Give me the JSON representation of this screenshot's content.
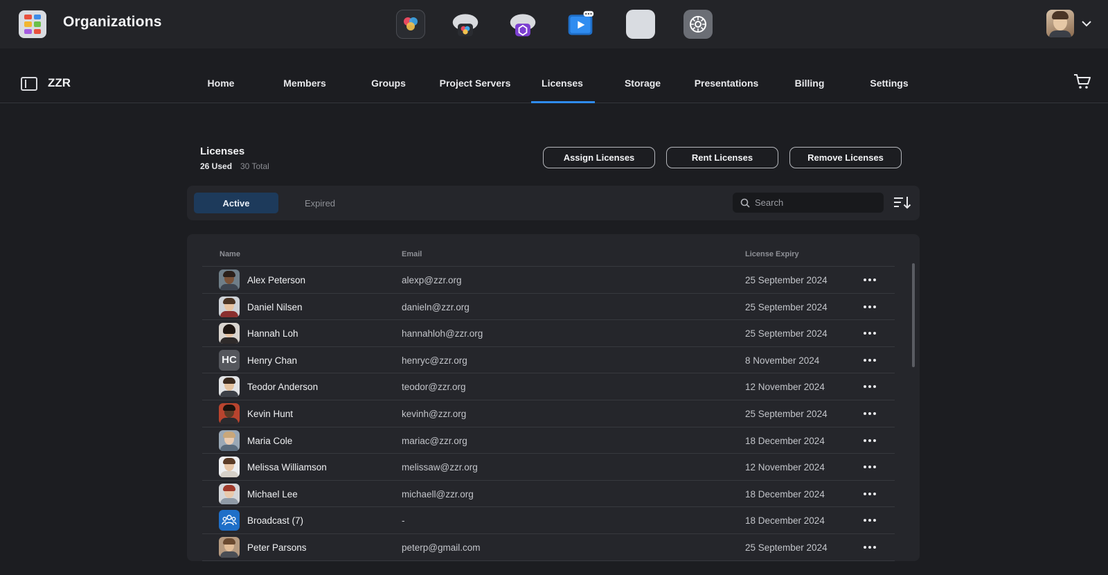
{
  "app": {
    "title": "Organizations"
  },
  "dock_apps": [
    {
      "icon": "davinci-resolve-icon"
    },
    {
      "icon": "cloud-resolve-icon"
    },
    {
      "icon": "cloud-database-icon"
    },
    {
      "icon": "presentation-player-icon"
    },
    {
      "icon": "organizations-icon"
    },
    {
      "icon": "system-preferences-icon"
    }
  ],
  "nav": {
    "org_name": "ZZR",
    "items": [
      {
        "label": "Home"
      },
      {
        "label": "Members"
      },
      {
        "label": "Groups"
      },
      {
        "label": "Project Servers"
      },
      {
        "label": "Licenses"
      },
      {
        "label": "Storage"
      },
      {
        "label": "Presentations"
      },
      {
        "label": "Billing"
      },
      {
        "label": "Settings"
      }
    ],
    "active": "Licenses"
  },
  "licenses": {
    "title": "Licenses",
    "used": "26 Used",
    "total": "30 Total",
    "buttons": {
      "assign": "Assign Licenses",
      "rent": "Rent Licenses",
      "remove": "Remove Licenses"
    },
    "tabs": {
      "active": "Active",
      "expired": "Expired"
    },
    "search": {
      "placeholder": "Search",
      "value": ""
    },
    "columns": {
      "name": "Name",
      "email": "Email",
      "expiry": "License Expiry"
    },
    "rows": [
      {
        "name": "Alex Peterson",
        "email": "alexp@zzr.org",
        "expiry": "25 September 2024"
      },
      {
        "name": "Daniel Nilsen",
        "email": "danieln@zzr.org",
        "expiry": "25 September 2024"
      },
      {
        "name": "Hannah Loh",
        "email": "hannahloh@zzr.org",
        "expiry": "25 September 2024"
      },
      {
        "name": "Henry Chan",
        "email": "henryc@zzr.org",
        "expiry": "8 November 2024",
        "initials": "HC"
      },
      {
        "name": "Teodor Anderson",
        "email": "teodor@zzr.org",
        "expiry": "12 November 2024"
      },
      {
        "name": "Kevin Hunt",
        "email": "kevinh@zzr.org",
        "expiry": "25 September 2024"
      },
      {
        "name": "Maria Cole",
        "email": "mariac@zzr.org",
        "expiry": "18 December 2024"
      },
      {
        "name": "Melissa Williamson",
        "email": "melissaw@zzr.org",
        "expiry": "12 November 2024"
      },
      {
        "name": "Michael Lee",
        "email": "michaell@zzr.org",
        "expiry": "18 December 2024"
      },
      {
        "name": "Broadcast (7)",
        "email": "-",
        "expiry": "18 December 2024"
      },
      {
        "name": "Peter Parsons",
        "email": "peterp@gmail.com",
        "expiry": "25 September 2024"
      }
    ]
  },
  "colors": {
    "accent": "#2f8cf0",
    "active_tab": "#1d3a5b",
    "background": "#1c1d21",
    "panel": "#25262b"
  }
}
